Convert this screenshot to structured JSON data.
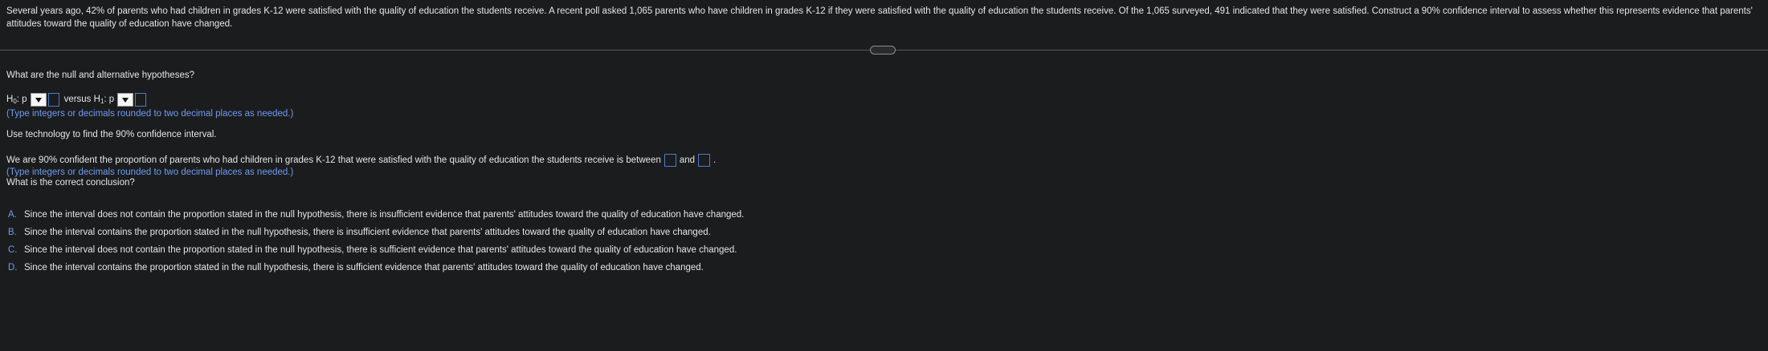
{
  "problem": {
    "text": "Several years ago, 42% of parents who had children in grades K-12 were satisfied with the quality of education the students receive. A recent poll asked 1,065 parents who have children in grades K-12 if they were satisfied with the quality of education the students receive. Of the 1,065 surveyed, 491 indicated that they were satisfied. Construct a 90% confidence interval to assess whether this represents evidence that parents' attitudes toward the quality of education have changed."
  },
  "hypotheses": {
    "question": "What are the null and alternative hypotheses?",
    "h0_prefix": "H",
    "h0_sub": "0",
    "h0_suffix": ": p",
    "versus": "versus H",
    "h1_sub": "1",
    "h1_suffix": ": p",
    "hint": "(Type integers or decimals rounded to two decimal places as needed.)"
  },
  "technology": {
    "instruction": "Use technology to find the 90% confidence interval."
  },
  "interval": {
    "sentence": "We are 90% confident the proportion of parents who had children in grades K-12 that were satisfied with the quality of education the students receive is between",
    "and": "and",
    "period": ".",
    "hint": "(Type integers or decimals rounded to two decimal places as needed.)"
  },
  "conclusion": {
    "question": "What is the correct conclusion?",
    "options": [
      {
        "letter": "A.",
        "text": "Since the interval does not contain the proportion stated in the null hypothesis, there is insufficient evidence that parents' attitudes toward the quality of education have changed."
      },
      {
        "letter": "B.",
        "text": "Since the interval contains the proportion stated in the null hypothesis, there is insufficient evidence that parents' attitudes toward the quality of education have changed."
      },
      {
        "letter": "C.",
        "text": "Since the interval does not contain the proportion stated in the null hypothesis, there is sufficient evidence that parents' attitudes toward the quality of education have changed."
      },
      {
        "letter": "D.",
        "text": "Since the interval contains the proportion stated in the null hypothesis, there is sufficient evidence that parents' attitudes toward the quality of education have changed."
      }
    ]
  },
  "colors": {
    "background": "#1b1c1e",
    "text": "#e6e6e6",
    "accent": "#6f9cf0",
    "answer_box_border": "#4a7bd1"
  },
  "icons": {
    "dropdown": "dropdown-triangle-icon",
    "divider": "resize-handle-icon"
  }
}
